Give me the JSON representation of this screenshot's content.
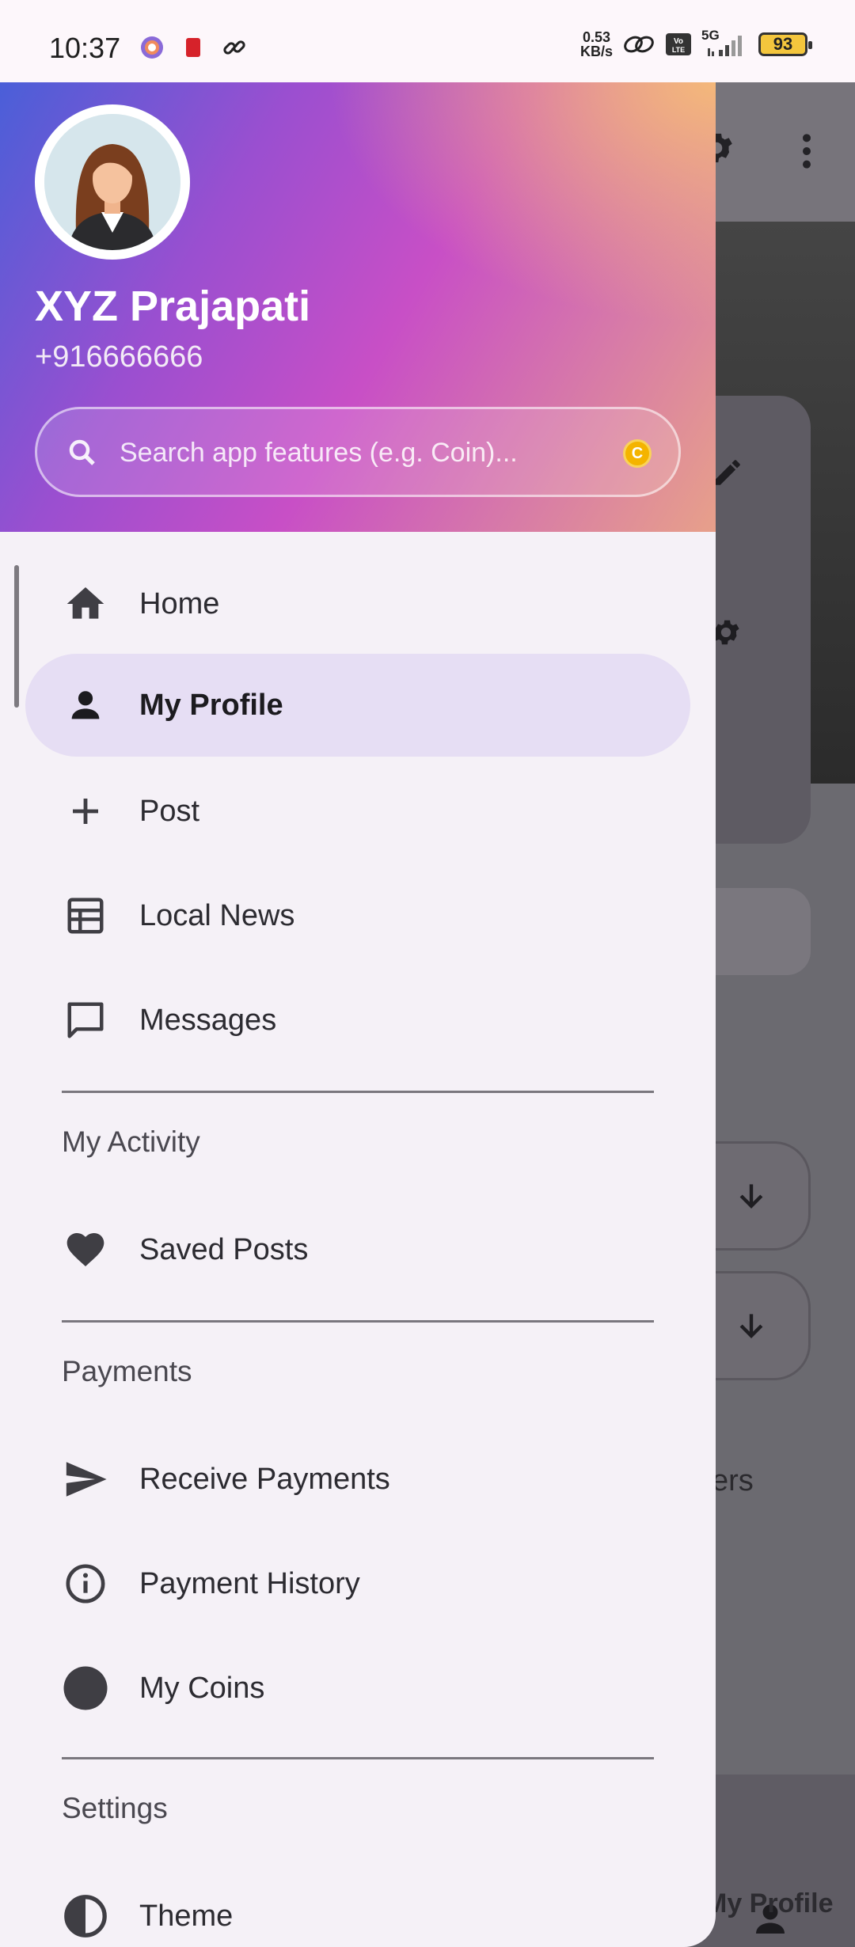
{
  "status_bar": {
    "time": "10:37",
    "net_speed_value": "0.53",
    "net_speed_unit": "KB/s",
    "network": "5G",
    "battery": "93",
    "left_icons": [
      "app-notification-icon",
      "book-icon",
      "link-icon"
    ],
    "right_icons": [
      "link-icon",
      "volte-icon",
      "signal-icon",
      "battery-icon"
    ]
  },
  "drawer": {
    "user": {
      "name": "XYZ Prajapati",
      "phone": "+916666666"
    },
    "search": {
      "placeholder": "Search app features (e.g. Coin)..."
    },
    "items": [
      {
        "label": "Home",
        "icon": "home-icon",
        "active": false
      },
      {
        "label": "My Profile",
        "icon": "person-icon",
        "active": true
      },
      {
        "label": "Post",
        "icon": "plus-icon",
        "active": false
      },
      {
        "label": "Local News",
        "icon": "newspaper-icon",
        "active": false
      },
      {
        "label": "Messages",
        "icon": "chat-icon",
        "active": false
      }
    ],
    "sections": [
      {
        "title": "My Activity",
        "items": [
          {
            "label": "Saved Posts",
            "icon": "heart-icon"
          }
        ]
      },
      {
        "title": "Payments",
        "items": [
          {
            "label": "Receive Payments",
            "icon": "send-icon"
          },
          {
            "label": "Payment History",
            "icon": "info-icon"
          },
          {
            "label": "My Coins",
            "icon": "coin-circle-icon"
          }
        ]
      },
      {
        "title": "Settings",
        "items": [
          {
            "label": "Theme",
            "icon": "contrast-icon"
          }
        ]
      }
    ]
  },
  "background": {
    "partial_text": "kers",
    "bottom_nav_label": "My Profile"
  },
  "colors": {
    "drawer_bg": "#f5f1f7",
    "active_item_bg": "#e6def4",
    "scrim": "#6b6a70"
  }
}
